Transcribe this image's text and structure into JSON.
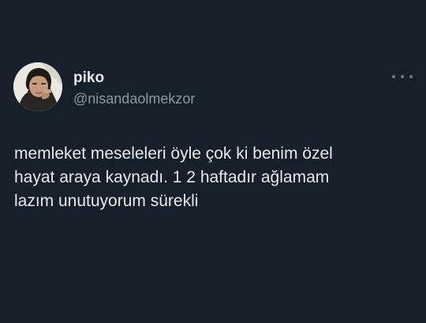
{
  "tweet": {
    "author": {
      "display_name": "piko",
      "handle": "@nisandaolmekzor",
      "avatar_icon": "profile-photo"
    },
    "more_icon": "more-horizontal-icon",
    "text_lines": [
      "memleket meseleleri öyle çok ki benim özel",
      "hayat araya kaynadı. 1 2 haftadır ağlamam",
      "lazım unutuyorum sürekli"
    ]
  },
  "colors": {
    "background": "#15202b",
    "primary_text": "#e7e9ea",
    "secondary_text": "#8b98a5"
  }
}
